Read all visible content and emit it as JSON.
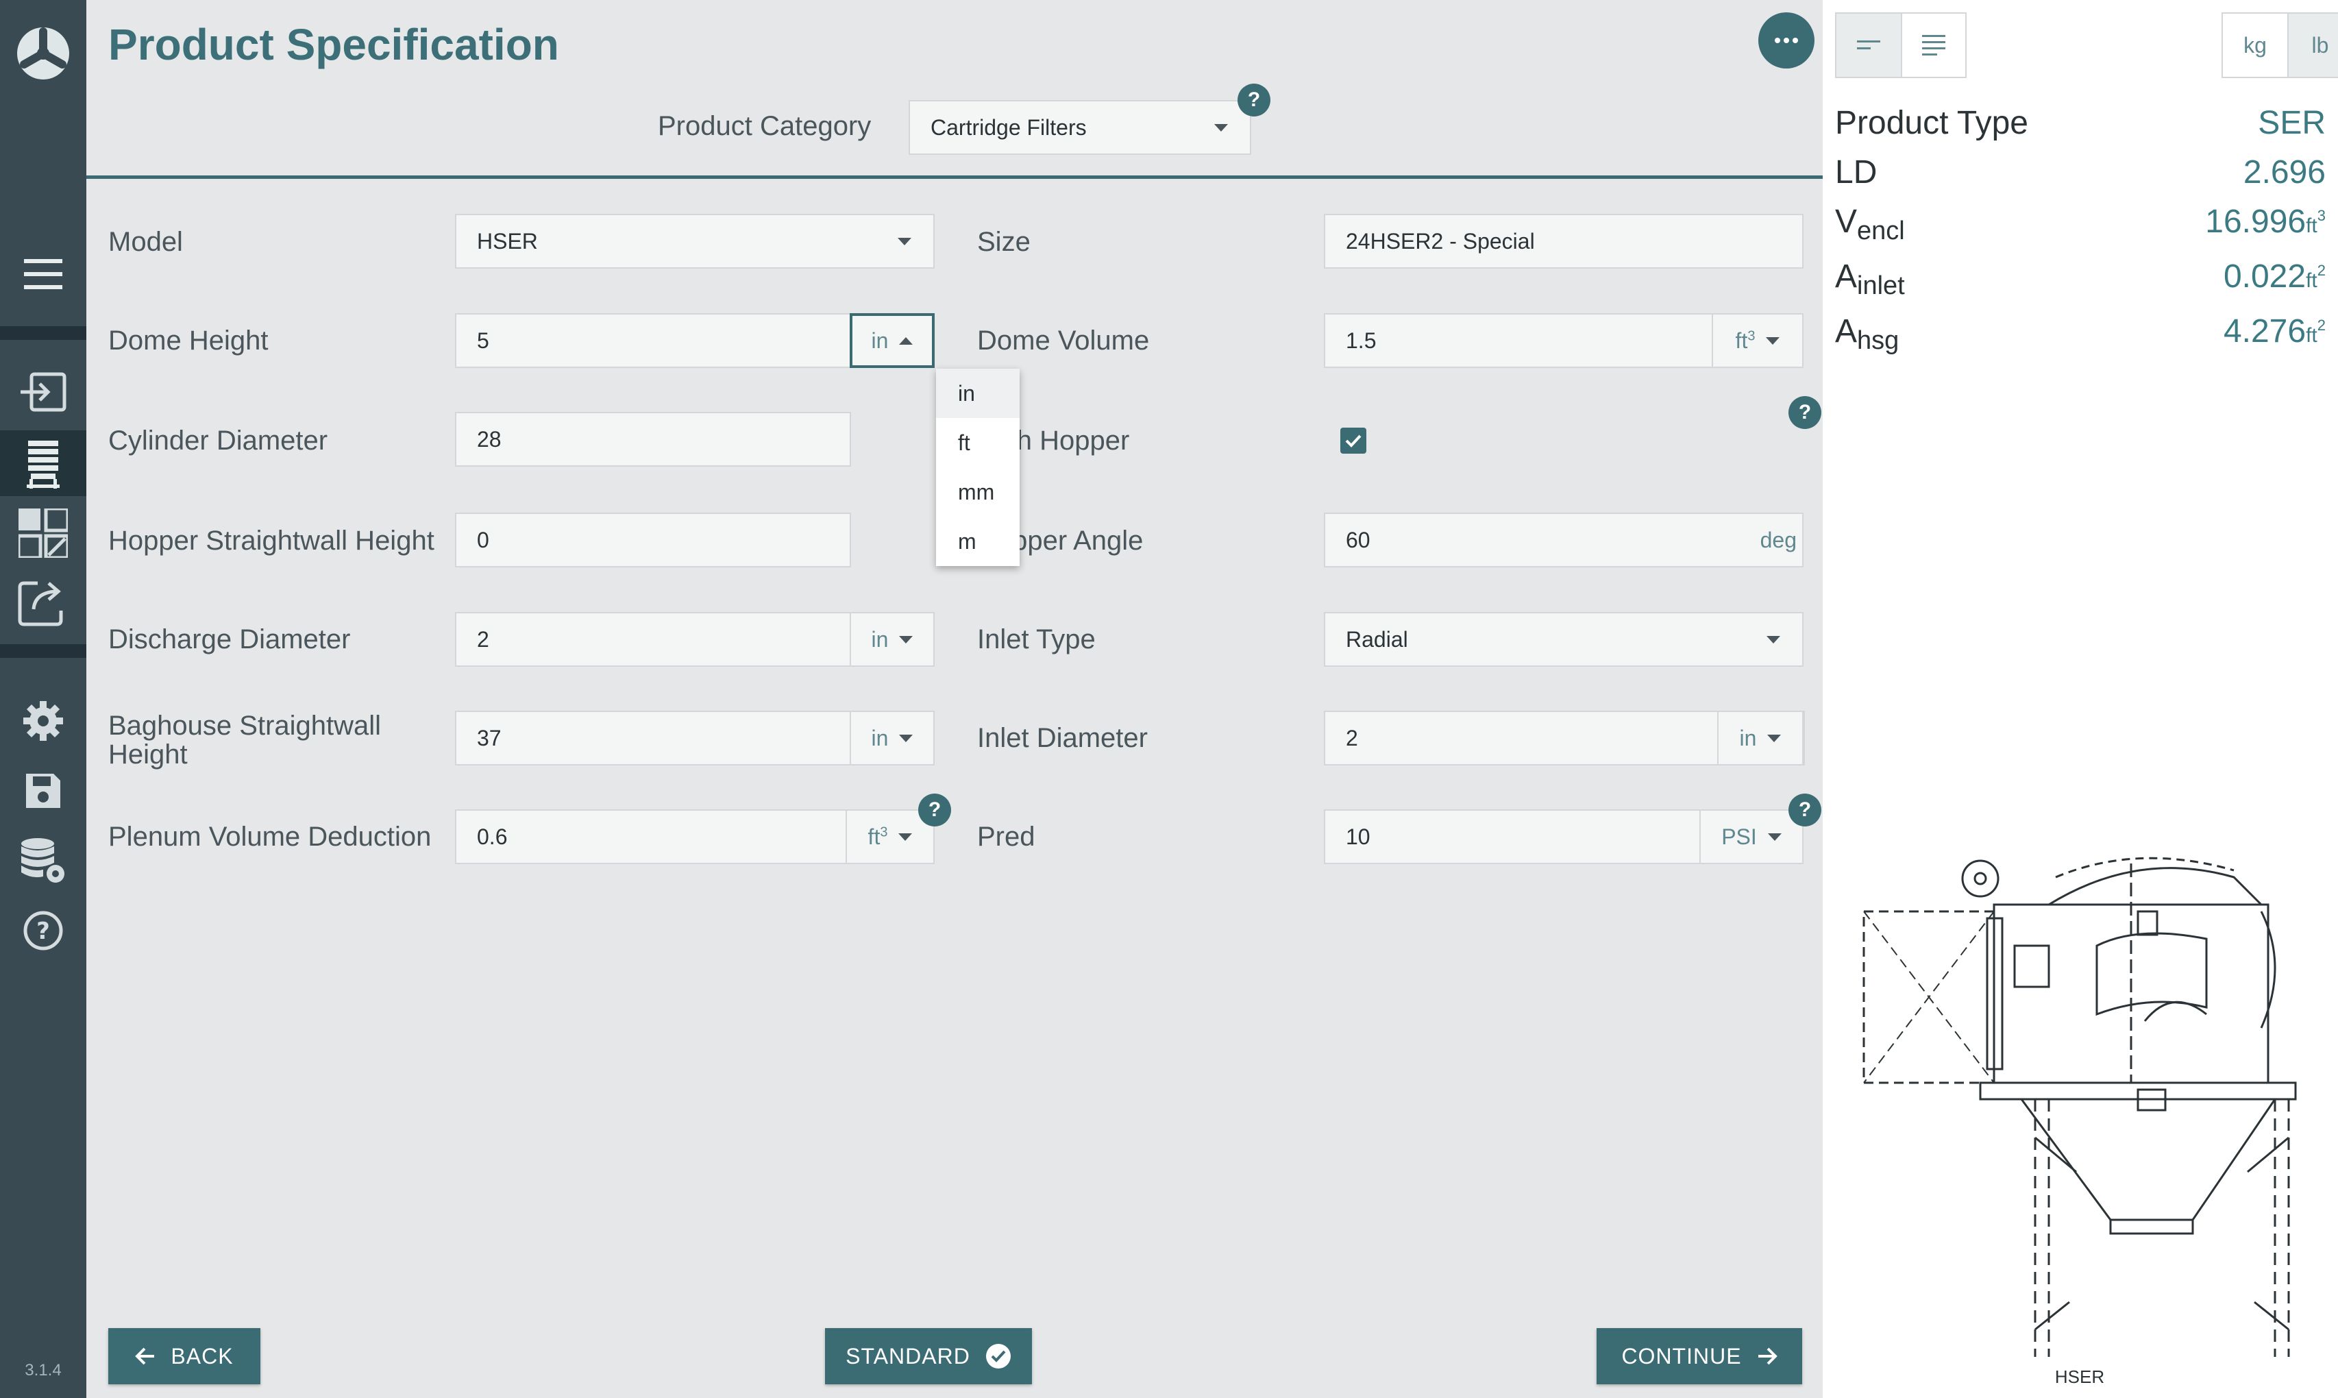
{
  "app": {
    "version": "3.1.4"
  },
  "header": {
    "title": "Product Specification",
    "category_label": "Product Category",
    "category_value": "Cartridge Filters"
  },
  "form": {
    "model": {
      "label": "Model",
      "value": "HSER"
    },
    "dome_height": {
      "label": "Dome Height",
      "value": "5",
      "unit": "in"
    },
    "cylinder_diameter": {
      "label": "Cylinder Diameter",
      "value": "28"
    },
    "hopper_straightwall_height": {
      "label": "Hopper Straightwall Height",
      "value": "0"
    },
    "discharge_diameter": {
      "label": "Discharge Diameter",
      "value": "2",
      "unit": "in"
    },
    "baghouse_straightwall_height": {
      "label_line1": "Baghouse Straightwall",
      "label_line2": "Height",
      "value": "37",
      "unit": "in"
    },
    "plenum_volume_deduction": {
      "label": "Plenum Volume Deduction",
      "value": "0.6",
      "unit": "ft",
      "unit_sup": "3"
    },
    "size": {
      "label": "Size",
      "value": "24HSER2 - Special"
    },
    "dome_volume": {
      "label": "Dome Volume",
      "value": "1.5",
      "unit": "ft",
      "unit_sup": "3"
    },
    "with_hopper": {
      "label": "With Hopper",
      "checked": true
    },
    "hopper_angle": {
      "label": "Hopper Angle",
      "value": "60",
      "unit": "deg"
    },
    "inlet_type": {
      "label": "Inlet Type",
      "value": "Radial"
    },
    "inlet_diameter": {
      "label": "Inlet Diameter",
      "value": "2",
      "unit": "in"
    },
    "pred": {
      "label": "Pred",
      "value": "10",
      "unit": "PSI"
    }
  },
  "unit_menu": {
    "options": [
      "in",
      "ft",
      "mm",
      "m"
    ],
    "selected": "in"
  },
  "help_glyph": "?",
  "buttons": {
    "back": "BACK",
    "standard": "STANDARD",
    "continue": "CONTINUE"
  },
  "right_panel": {
    "weight_units": [
      "kg",
      "lb"
    ],
    "active_weight_unit": "lb",
    "product_type": {
      "label": "Product Type",
      "value": "SER"
    },
    "ld": {
      "label": "LD",
      "value": "2.696"
    },
    "v_encl": {
      "symbol": "V",
      "subscript": "encl",
      "value": "16.996",
      "unit": "ft",
      "unit_sup": "3"
    },
    "a_inlet": {
      "symbol": "A",
      "subscript": "inlet",
      "value": "0.022",
      "unit": "ft",
      "unit_sup": "2"
    },
    "a_hsg": {
      "symbol": "A",
      "subscript": "hsg",
      "value": "4.276",
      "unit": "ft",
      "unit_sup": "2"
    },
    "drawing_label": "HSER"
  },
  "colors": {
    "accent": "#3b6b73",
    "sidebar": "#394a52",
    "title": "#3c6f78",
    "background": "#e5e7e8"
  },
  "icons": [
    "logo-icon",
    "menu-icon",
    "login-icon",
    "silo-icon",
    "dashboard-icon",
    "export-icon",
    "gear-icon",
    "save-icon",
    "database-settings-icon",
    "help-icon",
    "more-icon",
    "arrow-left-icon",
    "check-circle-icon",
    "arrow-right-icon",
    "align-short-icon",
    "align-full-icon"
  ]
}
